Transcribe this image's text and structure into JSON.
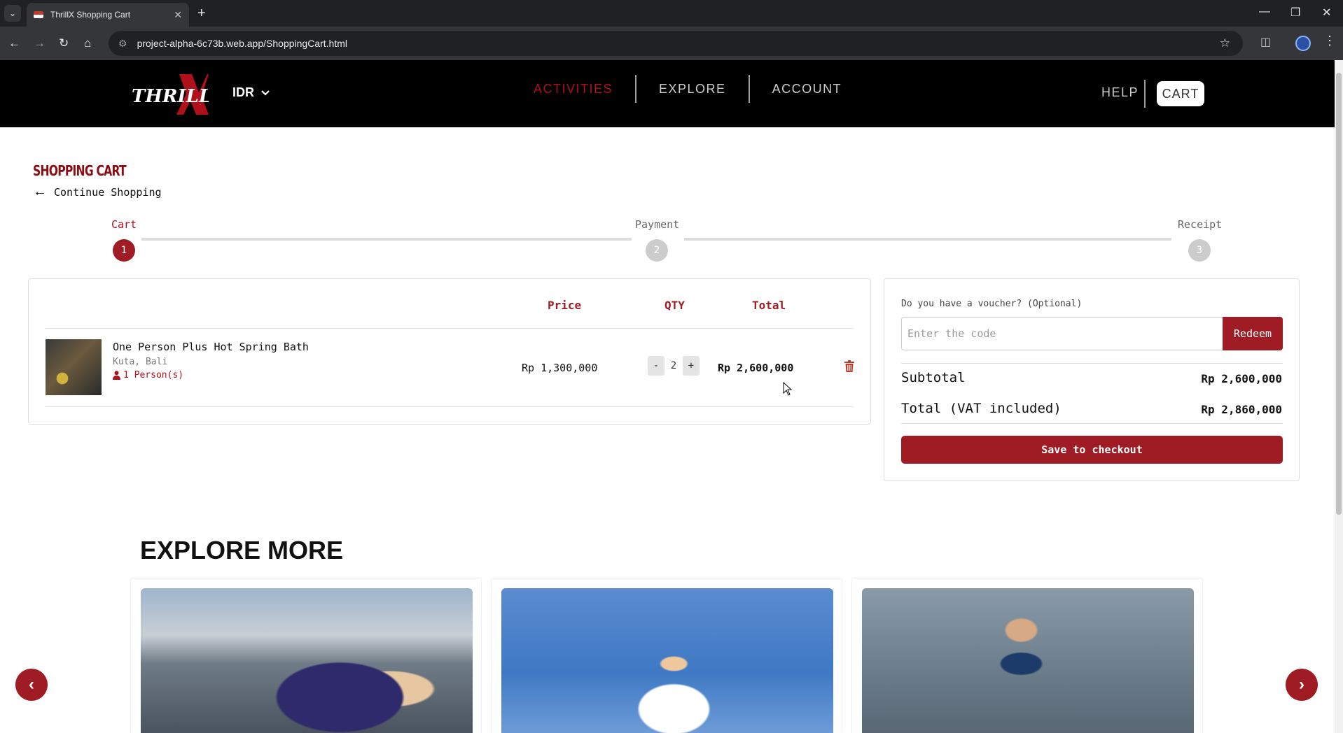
{
  "browser": {
    "tab_title": "ThrillX Shopping Cart",
    "url_host": "project-alpha-6c73b.web.app",
    "url_path": "/ShoppingCart.html"
  },
  "header": {
    "logo_text": "THRILLX",
    "currency": "IDR",
    "nav": [
      "ACTIVITIES",
      "EXPLORE",
      "ACCOUNT"
    ],
    "active_nav": "ACTIVITIES",
    "help": "HELP",
    "cart": "CART"
  },
  "cart_page": {
    "title": "SHOPPING CART",
    "continue": "Continue Shopping",
    "steps": [
      {
        "label": "Cart",
        "number": "1",
        "active": true
      },
      {
        "label": "Payment",
        "number": "2",
        "active": false
      },
      {
        "label": "Receipt",
        "number": "3",
        "active": false
      }
    ],
    "table_headers": {
      "price": "Price",
      "qty": "QTY",
      "total": "Total"
    },
    "items": [
      {
        "name": "One Person Plus Hot Spring Bath",
        "location": "Kuta, Bali",
        "persons": "1 Person(s)",
        "price": "Rp 1,300,000",
        "qty": "2",
        "total": "Rp 2,600,000"
      }
    ],
    "qty_minus": "-",
    "qty_plus": "+"
  },
  "summary": {
    "voucher_label": "Do you have a voucher? (Optional)",
    "voucher_placeholder": "Enter the code",
    "redeem": "Redeem",
    "subtotal_label": "Subtotal",
    "subtotal_value": "Rp 2,600,000",
    "total_label": "Total (VAT included)",
    "total_value": "Rp 2,860,000",
    "checkout": "Save to checkout"
  },
  "explore": {
    "title": "EXPLORE MORE"
  },
  "colors": {
    "brand_red": "#a01c24",
    "header_bg": "#000000"
  }
}
